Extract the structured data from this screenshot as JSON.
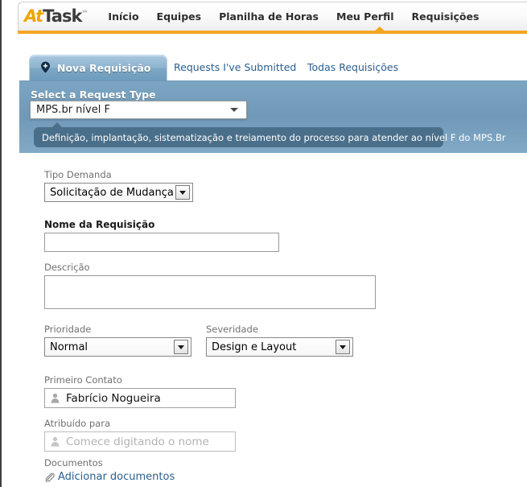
{
  "brand": {
    "logo_prefix": "At",
    "logo_suffix": "Task",
    "logo_tm": "™",
    "accent_orange": "#f5a623",
    "panel_blue": "#7099b8",
    "tooltip_blue": "#4a6f8a",
    "link_blue": "#2a5f8f"
  },
  "nav": {
    "items": [
      {
        "label": "Início",
        "active": false
      },
      {
        "label": "Equipes",
        "active": false
      },
      {
        "label": "Planilha de Horas",
        "active": false
      },
      {
        "label": "Meu Perfil",
        "active": false
      },
      {
        "label": "Requisições",
        "active": true
      }
    ]
  },
  "tabs": {
    "active": {
      "label": "Nova Requisição",
      "icon": "map-pin-plus-icon"
    },
    "others": [
      {
        "label": "Requests I've Submitted"
      },
      {
        "label": "Todas Requisições"
      }
    ]
  },
  "request_type": {
    "label": "Select a Request Type",
    "selected": "MPS.br nível F",
    "tooltip": "Definição, implantação, sistematização e treiamento do processo para atender ao nível F do MPS.Br"
  },
  "form": {
    "tipo_demanda": {
      "label": "Tipo Demanda",
      "value": "Solicitação de Mudança"
    },
    "nome_requisicao": {
      "label": "Nome da Requisição",
      "value": ""
    },
    "descricao": {
      "label": "Descrição",
      "value": ""
    },
    "prioridade": {
      "label": "Prioridade",
      "value": "Normal"
    },
    "severidade": {
      "label": "Severidade",
      "value": "Design e Layout"
    },
    "primeiro_contato": {
      "label": "Primeiro Contato",
      "value": "Fabrício Nogueira",
      "icon": "person-icon"
    },
    "atribuido_para": {
      "label": "Atribuído para",
      "value": "",
      "placeholder": "Comece digitando o nome",
      "icon": "person-icon"
    },
    "documentos": {
      "label": "Documentos",
      "link_label": "Adicionar documentos",
      "icon": "paperclip-icon"
    }
  }
}
